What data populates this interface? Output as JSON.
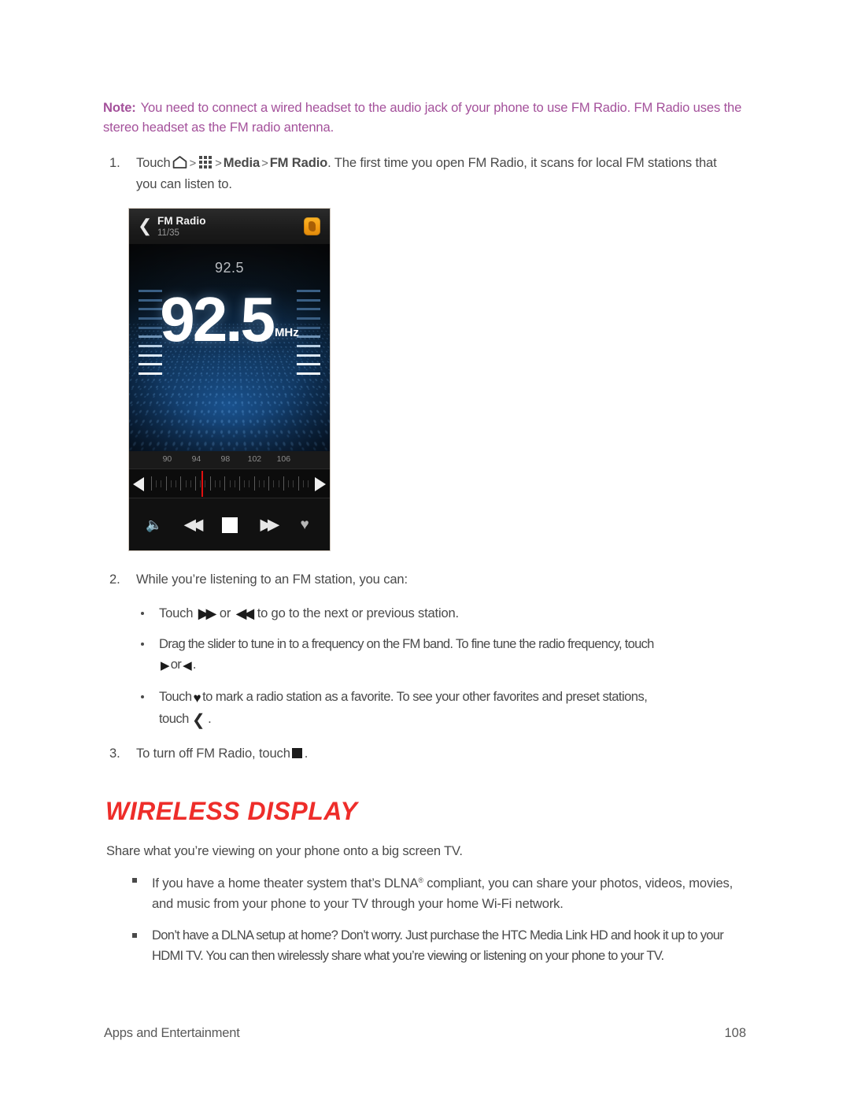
{
  "note": {
    "label": "Note:",
    "text": "You need to connect a wired headset to the audio jack of your phone to use FM Radio. FM Radio uses the stereo headset as the FM radio antenna."
  },
  "steps": [
    {
      "number": "1.",
      "text_before": "Touch",
      "icon_home": "home-icon",
      "sep1": ">",
      "icon_grid": "apps-grid-icon",
      "sep2": ">",
      "bold1": "Media",
      "sep3": ">",
      "bold2": "FM Radio",
      "text_after": ". The first time you open FM Radio, it scans for local FM stations that you can listen to."
    },
    {
      "number": "2.",
      "text": "While you’re listening to an FM station, you can:"
    },
    {
      "number": "3.",
      "text_before": "To turn off FM Radio, touch",
      "icon": "stop-icon",
      "text_after": "."
    }
  ],
  "bullets_fm": [
    {
      "part1": "Touch",
      "icon1": "fast-forward-icon",
      "mid": "or",
      "icon2": "rewind-icon",
      "part2": "to go to the next or previous station."
    },
    {
      "part1": "Drag the slider to tune in to a frequency on the FM band. To fine tune the radio frequency, touch",
      "icon1": "play-right-triangle-icon",
      "mid": "or",
      "icon2": "play-left-triangle-icon",
      "part2": "."
    },
    {
      "part1": "Touch",
      "icon1": "heart-icon",
      "part2": "to mark a radio station as a favorite. To see your other favorites and preset stations,",
      "part3": "touch",
      "icon2": "back-chevron-icon",
      "part4": "."
    }
  ],
  "section": {
    "heading": "WIRELESS DISPLAY",
    "intro": "Share what you’re viewing on your phone onto a big screen TV.",
    "bullets": [
      {
        "pre": "If you have a home theater system that’s DLNA",
        "sup": "®",
        "post": "compliant, you can share your photos, videos, movies, and music from your phone to your TV through your home Wi-Fi network."
      },
      {
        "pre": "Don’t have a DLNA setup at home? Don’t worry. Just purchase the HTC Media Link HD and hook it up to your HDMI TV. You can then wirelessly share what you’re viewing or listening on your phone to your TV.",
        "sup": "",
        "post": ""
      }
    ]
  },
  "footer": {
    "left": "Apps and Entertainment",
    "page": "108"
  },
  "phone": {
    "header": {
      "back_icon": "back-chevron-icon",
      "title": "FM Radio",
      "subtitle": "11/35",
      "app_icon": "fm-radio-app-icon"
    },
    "display": {
      "small_frequency": "92.5",
      "big_frequency": "92.5",
      "unit": "MHz"
    },
    "scale": {
      "ticks": [
        "90",
        "94",
        "98",
        "102",
        "106"
      ],
      "marker_position_percent": 32
    },
    "tuner": {
      "left_arrow": "tune-down-icon",
      "right_arrow": "tune-up-icon"
    },
    "controls": [
      {
        "name": "volume-icon",
        "glyph": "🔊"
      },
      {
        "name": "rewind-icon",
        "glyph": "◀◀"
      },
      {
        "name": "stop-icon",
        "glyph": ""
      },
      {
        "name": "fast-forward-icon",
        "glyph": "▶▶"
      },
      {
        "name": "favorite-heart-icon",
        "glyph": "♥"
      }
    ]
  },
  "colors": {
    "note": "#a4519b",
    "heading": "#ee2d2a",
    "body": "#4a4a4a",
    "accent_orange": "#f4a41b",
    "marker_red": "#e01010"
  }
}
